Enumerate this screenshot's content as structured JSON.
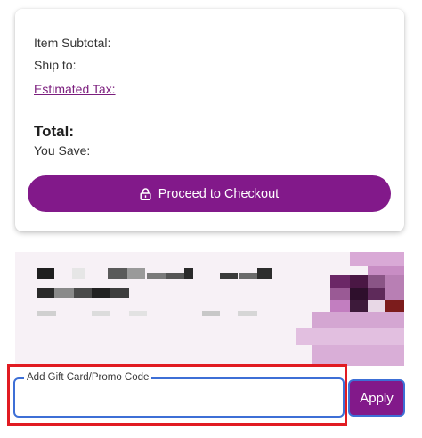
{
  "summary": {
    "subtotal_label": "Item Subtotal:",
    "ship_label": "Ship to:",
    "tax_label": "Estimated Tax:",
    "total_label": "Total:",
    "save_label": "You Save:"
  },
  "checkout": {
    "button_label": "Proceed to Checkout",
    "icon": "lock-icon"
  },
  "promo_banner": {
    "content": "pixelated-image"
  },
  "gift_card": {
    "legend": "Add Gift Card/Promo Code",
    "value": "",
    "apply_label": "Apply"
  },
  "colors": {
    "brand_purple": "#82198a",
    "link_purple": "#7b1d7d",
    "focus_blue": "#3d6fd6",
    "highlight_red": "#e11b22"
  }
}
